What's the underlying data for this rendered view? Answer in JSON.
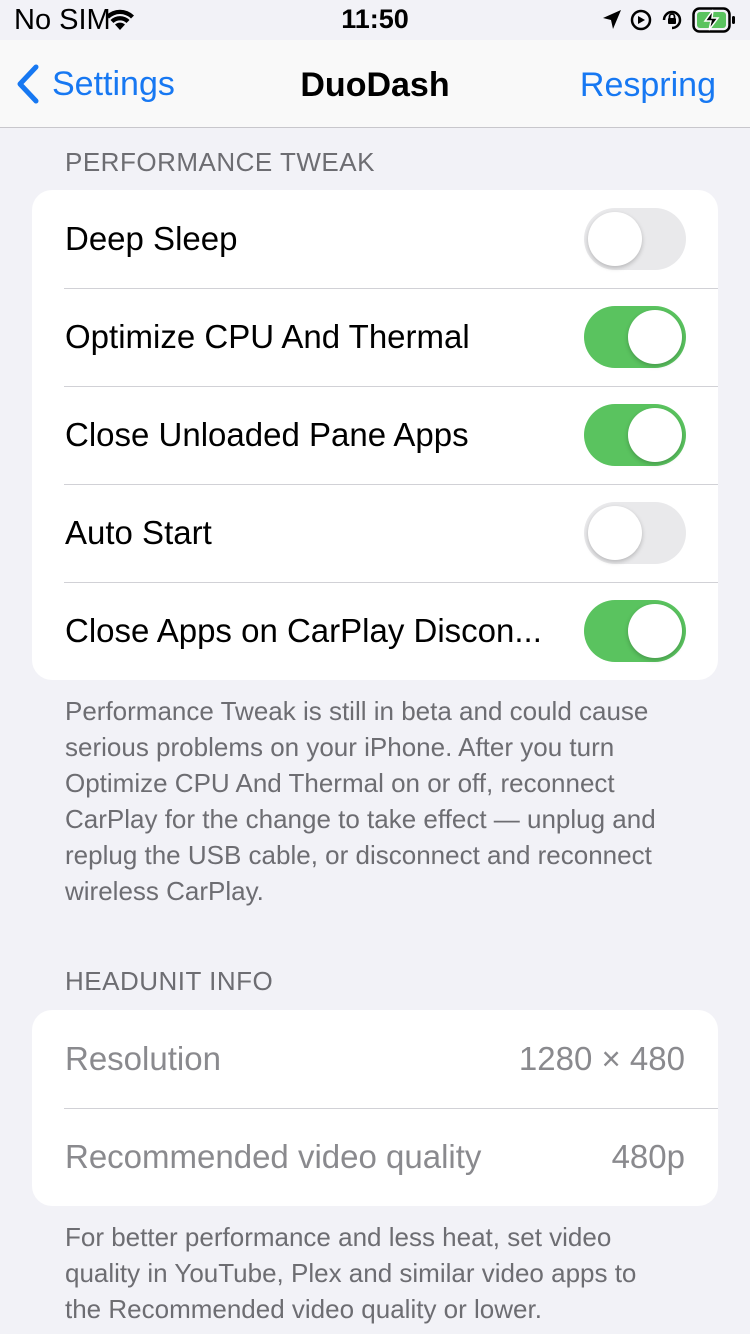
{
  "status_bar": {
    "carrier": "No SIM",
    "time": "11:50",
    "icons": [
      "wifi-icon",
      "location-icon",
      "alarm-icon",
      "orientation-lock-icon",
      "battery-charging-icon"
    ]
  },
  "nav": {
    "back_label": "Settings",
    "title": "DuoDash",
    "action_label": "Respring"
  },
  "colors": {
    "accent": "#1778f2",
    "toggle_on": "#5ac35f",
    "toggle_off": "#e9e9eb",
    "background": "#f2f2f7"
  },
  "performance": {
    "header": "PERFORMANCE TWEAK",
    "rows": [
      {
        "label": "Deep Sleep",
        "on": false
      },
      {
        "label": "Optimize CPU And Thermal",
        "on": true
      },
      {
        "label": "Close Unloaded Pane Apps",
        "on": true
      },
      {
        "label": "Auto Start",
        "on": false
      },
      {
        "label": "Close Apps on CarPlay Discon...",
        "on": true
      }
    ],
    "footer_lines": [
      "Performance Tweak is still in beta and could cause",
      "serious problems on your iPhone. After you turn",
      "Optimize CPU And Thermal on or off, reconnect",
      "CarPlay for the change to take effect — unplug and",
      "replug the USB cable, or disconnect and reconnect",
      "wireless CarPlay."
    ]
  },
  "headunit": {
    "header": "HEADUNIT INFO",
    "rows": [
      {
        "label": "Resolution",
        "value": "1280 × 480"
      },
      {
        "label": "Recommended video quality",
        "value": "480p"
      }
    ],
    "footer_lines": [
      "For better performance and less heat, set video",
      "quality in YouTube, Plex and similar video apps to",
      "the Recommended video quality or lower."
    ]
  }
}
